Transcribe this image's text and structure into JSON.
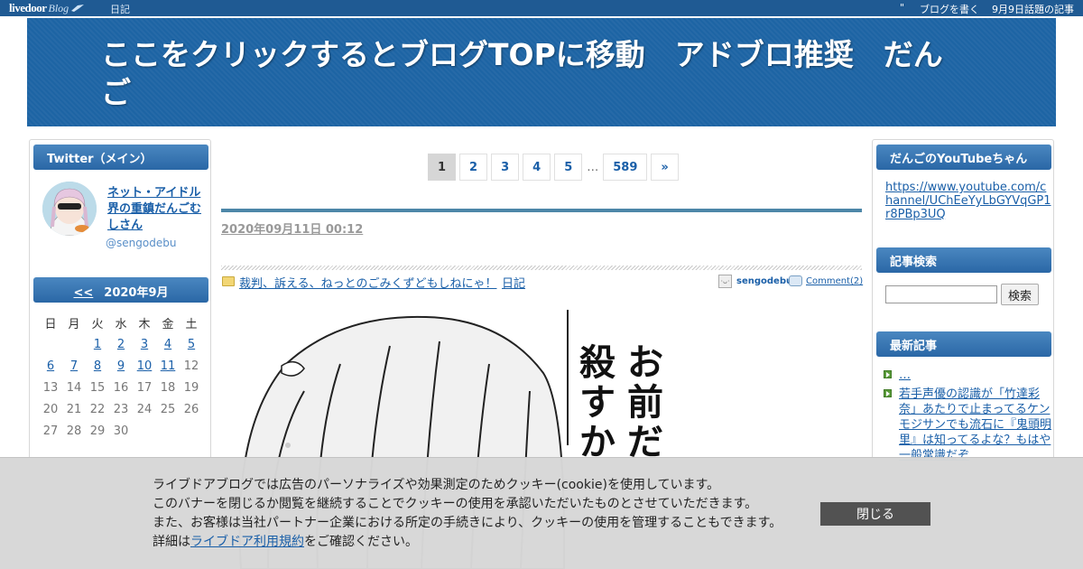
{
  "topbar": {
    "logo_text": "livedoor",
    "logo_blog": "Blog",
    "diary": "日記",
    "write_blog": "ブログを書く",
    "topic": "9月9日話題の記事"
  },
  "header": {
    "title": "ここをクリックするとブログTOPに移動　アドブロ推奨　だんご"
  },
  "left_sidebar": {
    "twitter_heading": "Twitter（メイン）",
    "twitter_name": "ネット・アイドル界の重鎮だんごむしさん",
    "twitter_handle": "@sengodebu",
    "calendar": {
      "prev_label": "<<",
      "month_label": "2020年9月",
      "weekdays": [
        "日",
        "月",
        "火",
        "水",
        "木",
        "金",
        "土"
      ],
      "rows": [
        [
          "",
          "",
          "1",
          "2",
          "3",
          "4",
          "5"
        ],
        [
          "6",
          "7",
          "8",
          "9",
          "10",
          "11",
          "12"
        ],
        [
          "13",
          "14",
          "15",
          "16",
          "17",
          "18",
          "19"
        ],
        [
          "20",
          "21",
          "22",
          "23",
          "24",
          "25",
          "26"
        ],
        [
          "27",
          "28",
          "29",
          "30",
          "",
          "",
          ""
        ]
      ],
      "linked_days": [
        "1",
        "2",
        "3",
        "4",
        "5",
        "6",
        "7",
        "8",
        "9",
        "10",
        "11"
      ]
    }
  },
  "pager": {
    "pages": [
      "1",
      "2",
      "3",
      "4",
      "5"
    ],
    "ellipsis": "…",
    "last": "589",
    "next": "»"
  },
  "post": {
    "date": "2020年09月11日 00:12",
    "title": "裁判、訴える、ねっとのごみくずどもしねにゃ！",
    "category": "日記",
    "author": "sengodebu",
    "comments": "Comment(2)",
    "image_text": [
      "お",
      "前",
      "だ",
      "殺",
      "す",
      "か"
    ]
  },
  "right_sidebar": {
    "youtube_heading": "だんごのYouTubeちゃん",
    "youtube_link": "https://www.youtube.com/channel/UChEeYyLbGYVqGP1r8PBp3UQ",
    "search_heading": "記事検索",
    "search_button": "検索",
    "recent_heading": "最新記事",
    "recent_items": [
      "…",
      "若手声優の認識が「竹達彩奈」あたりで止まってるケンモジサンでも流石に『鬼頭明里』は知ってるよな？もはや一般常識だぞ"
    ]
  },
  "cookie": {
    "line1": "ライブドアブログでは広告のパーソナライズや効果測定のためクッキー(cookie)を使用しています。",
    "line2": "このバナーを閉じるか閲覧を継続することでクッキーの使用を承認いただいたものとさせていただきます。",
    "line3": "また、お客様は当社パートナー企業における所定の手続きにより、クッキーの使用を管理することもできます。",
    "line4_prefix": "詳細は",
    "line4_link": "ライブドア利用規約",
    "line4_suffix": "をご確認ください。",
    "close_button": "閉じる"
  },
  "colors": {
    "topbar": "#1f5a93",
    "header": "#1d64a4",
    "link": "#1a5fa8",
    "cookie_bg": "#d7d7d7",
    "cookie_button": "#525252"
  }
}
